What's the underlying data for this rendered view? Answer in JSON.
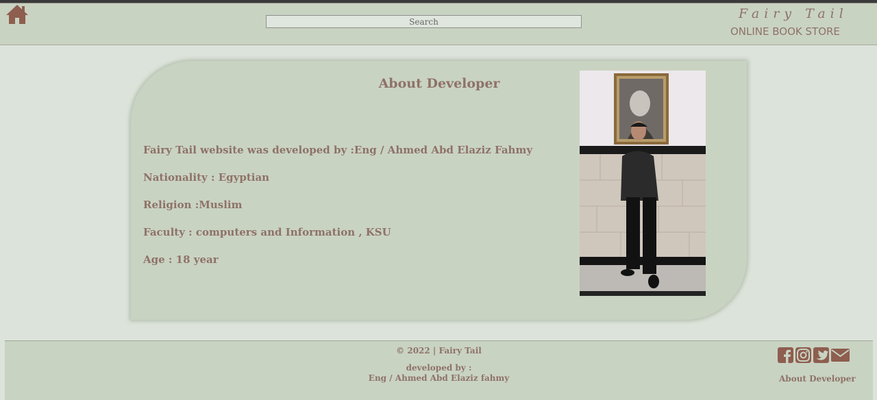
{
  "header": {
    "home_icon": "home-icon",
    "search_placeholder": "Search",
    "brand_title": "Fairy Tail",
    "brand_subtitle": "ONLINE BOOK STORE"
  },
  "about": {
    "title": "About Developer",
    "lines": [
      "Fairy Tail website was developed by :Eng / Ahmed Abd Elaziz Fahmy",
      "Nationality : Egyptian",
      "Religion :Muslim",
      "Faculty : computers and Information , KSU",
      "Age : 18 year"
    ]
  },
  "footer": {
    "copyright": "© 2022 | Fairy Tail",
    "developed_by": "developed by :",
    "developer_name": "Eng / Ahmed Abd Elaziz fahmy",
    "social_icons": [
      "facebook-icon",
      "instagram-icon",
      "twitter-icon",
      "mail-icon"
    ],
    "about_link": "About Developer"
  },
  "colors": {
    "accent": "#8e7268",
    "panel": "#c9d3c2",
    "page": "#dce3da"
  }
}
